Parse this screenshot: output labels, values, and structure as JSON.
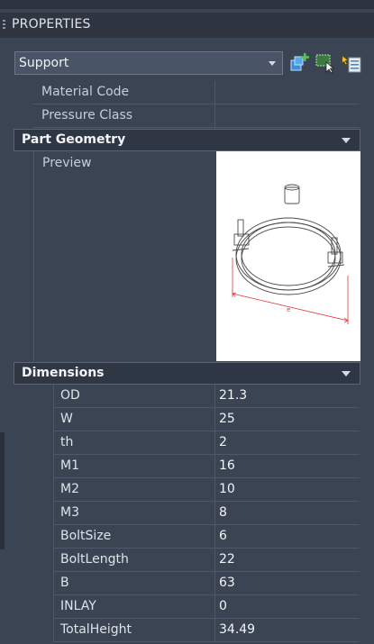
{
  "panel": {
    "title": "PROPERTIES"
  },
  "selector": {
    "value": "Support"
  },
  "toolbar": {
    "icons": [
      "add-part-icon",
      "select-objects-icon",
      "quick-select-icon"
    ]
  },
  "general_rows": [
    {
      "name": "Material Code",
      "value": ""
    },
    {
      "name": "Pressure Class",
      "value": ""
    }
  ],
  "sections": {
    "part_geometry": {
      "label": "Part Geometry",
      "preview_label": "Preview"
    },
    "dimensions": {
      "label": "Dimensions"
    }
  },
  "preview": {
    "dimension_letter": "e"
  },
  "dimensions": [
    {
      "key": "OD",
      "value": "21.3"
    },
    {
      "key": "W",
      "value": "25"
    },
    {
      "key": "th",
      "value": "2"
    },
    {
      "key": "M1",
      "value": "16"
    },
    {
      "key": "M2",
      "value": "10"
    },
    {
      "key": "M3",
      "value": "8"
    },
    {
      "key": "BoltSize",
      "value": "6"
    },
    {
      "key": "BoltLength",
      "value": "22"
    },
    {
      "key": "B",
      "value": "63"
    },
    {
      "key": "INLAY",
      "value": "0"
    },
    {
      "key": "TotalHeight",
      "value": "34.49"
    }
  ],
  "colors": {
    "panel_bg": "#3b4453",
    "header_bg": "#2f3642",
    "accent_green": "#58c15a",
    "accent_blue": "#3a8fd9"
  }
}
